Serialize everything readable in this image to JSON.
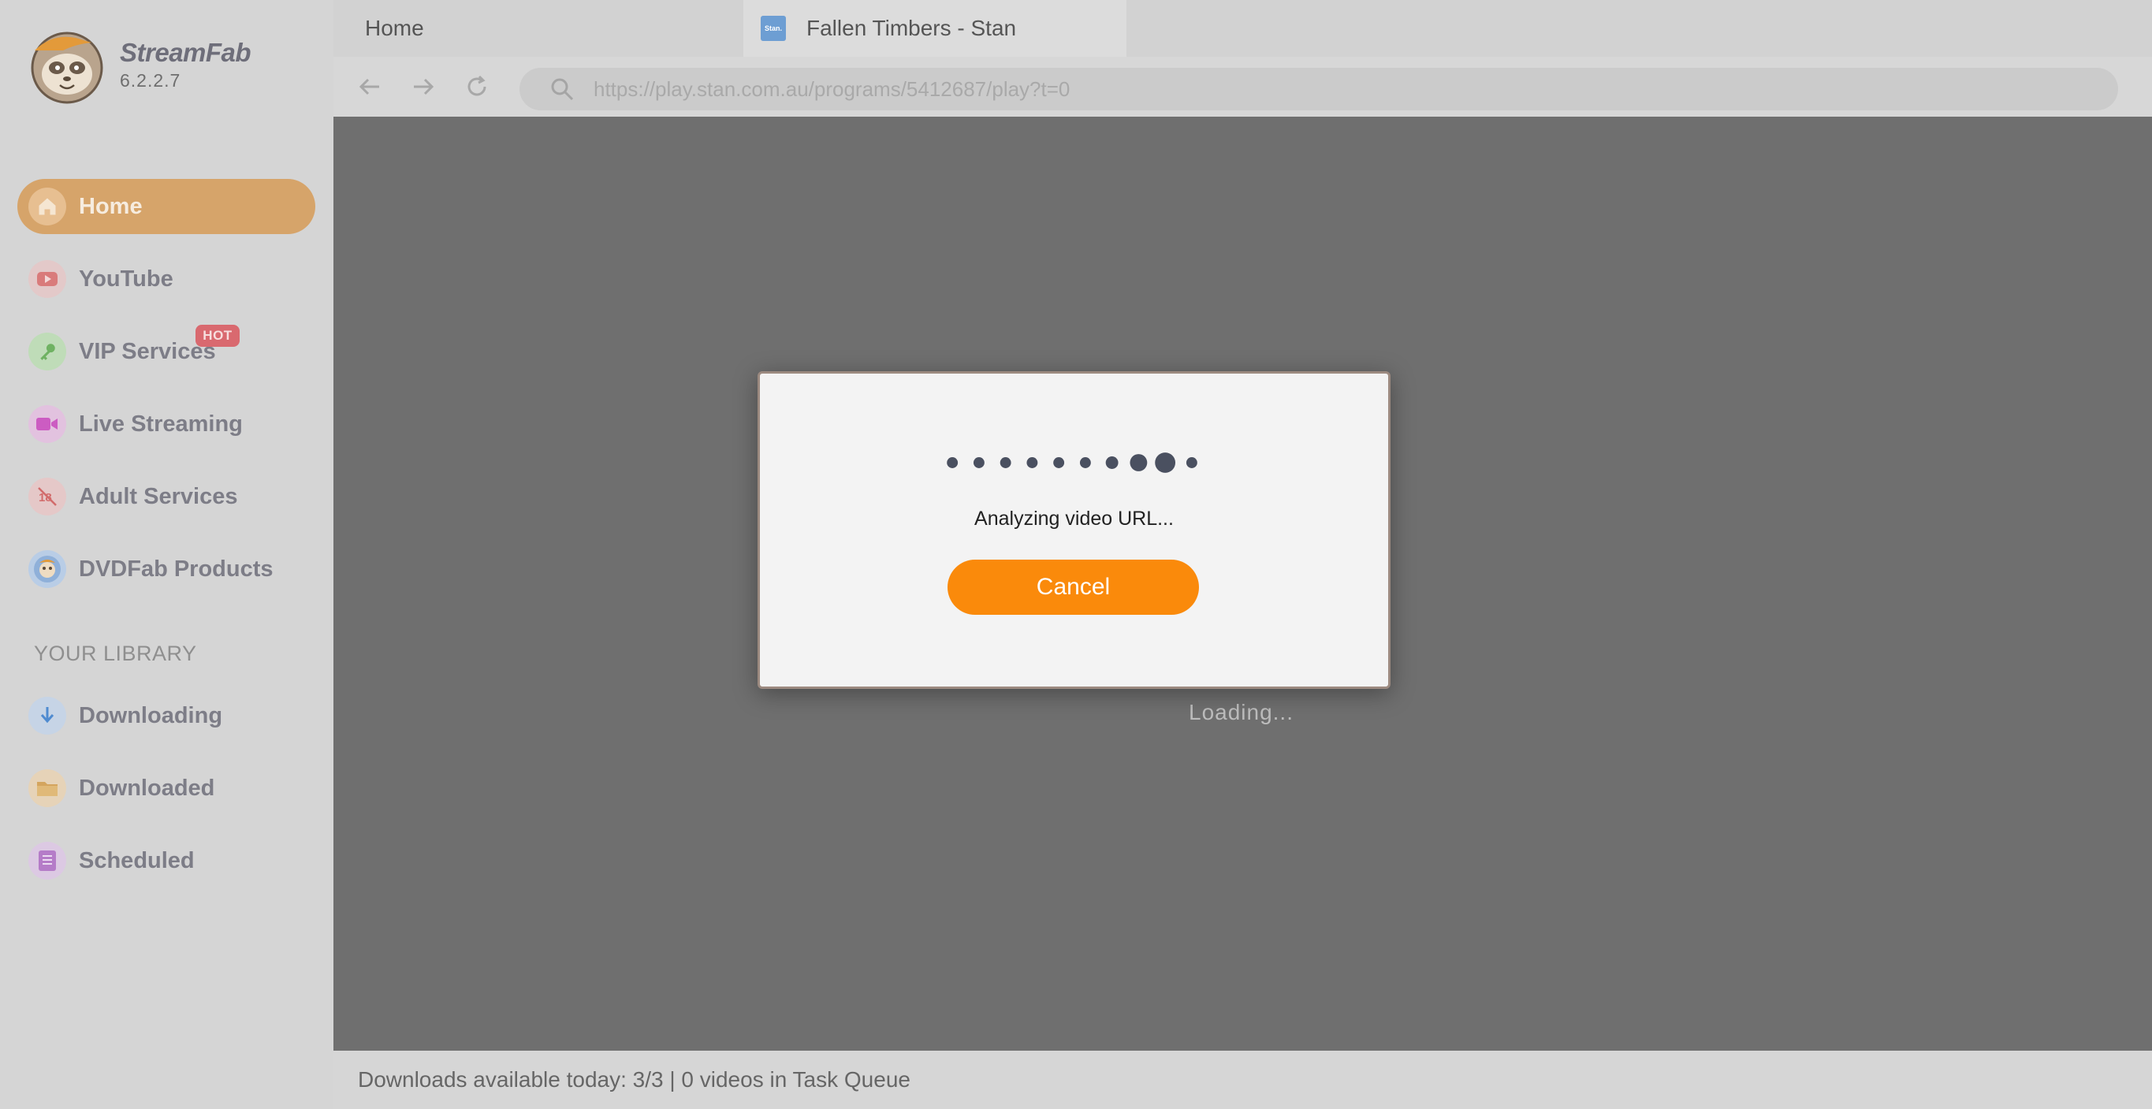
{
  "app": {
    "name": "StreamFab",
    "version": "6.2.2.7"
  },
  "sidebar": {
    "items": [
      {
        "label": "Home",
        "icon": "home-icon",
        "active": true
      },
      {
        "label": "YouTube",
        "icon": "youtube-icon"
      },
      {
        "label": "VIP Services",
        "icon": "key-icon",
        "badge": "HOT"
      },
      {
        "label": "Live Streaming",
        "icon": "video-camera-icon"
      },
      {
        "label": "Adult Services",
        "icon": "adult-18-icon"
      },
      {
        "label": "DVDFab Products",
        "icon": "dvdfab-icon"
      }
    ],
    "library_heading": "YOUR LIBRARY",
    "library_items": [
      {
        "label": "Downloading",
        "icon": "download-arrow-icon"
      },
      {
        "label": "Downloaded",
        "icon": "folder-icon"
      },
      {
        "label": "Scheduled",
        "icon": "list-icon"
      }
    ]
  },
  "tabs": [
    {
      "label": "Home"
    },
    {
      "label": "Fallen Timbers - Stan",
      "favicon_text": "Stan."
    }
  ],
  "address_bar": {
    "url": "https://play.stan.com.au/programs/5412687/play?t=0"
  },
  "content": {
    "loading_text": "Loading..."
  },
  "dialog": {
    "message": "Analyzing video URL...",
    "cancel_label": "Cancel"
  },
  "status_bar": {
    "text": "Downloads available today: 3/3 | 0 videos in Task Queue"
  },
  "colors": {
    "accent": "#d6a46a",
    "cancel_button": "#fa8a0b",
    "hot_badge": "#d9696f"
  }
}
